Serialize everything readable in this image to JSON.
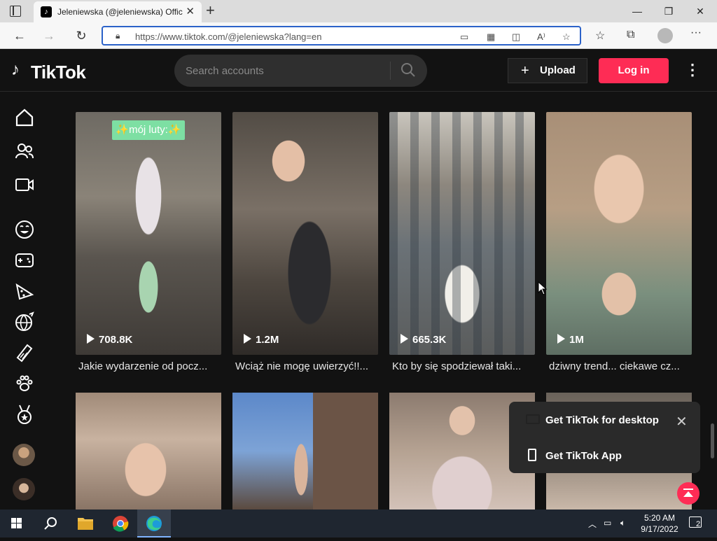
{
  "browser": {
    "tab_title": "Jeleniewska (@jeleniewska) Offic",
    "url": "https://www.tiktok.com/@jeleniewska?lang=en",
    "tab_favicon_icon": "tiktok-icon"
  },
  "header": {
    "logo_text": "TikTok",
    "search_placeholder": "Search accounts",
    "upload_label": "Upload",
    "login_label": "Log in",
    "accent_color": "#fe2c55"
  },
  "sidebar": {
    "items": [
      {
        "icon": "home-icon"
      },
      {
        "icon": "following-icon"
      },
      {
        "icon": "live-icon"
      },
      {
        "icon": "comedy-icon"
      },
      {
        "icon": "gaming-icon"
      },
      {
        "icon": "food-icon"
      },
      {
        "icon": "sports-icon"
      },
      {
        "icon": "beauty-icon"
      },
      {
        "icon": "animals-icon"
      },
      {
        "icon": "achievement-icon"
      }
    ]
  },
  "videos": [
    {
      "views": "708.8K",
      "caption": "Jakie wydarzenie od pocz...",
      "sticker": "✨mój luty:✨"
    },
    {
      "views": "1.2M",
      "caption": "Wciąż nie mogę uwierzyć!!..."
    },
    {
      "views": "665.3K",
      "caption": "Kto by się spodziewał taki..."
    },
    {
      "views": "1M",
      "caption": "dziwny trend... ciekawe cz..."
    }
  ],
  "popup": {
    "desktop_label": "Get TikTok for desktop",
    "app_label": "Get TikTok App"
  },
  "taskbar": {
    "time": "5:20 AM",
    "date": "9/17/2022",
    "notification_count": "2"
  }
}
